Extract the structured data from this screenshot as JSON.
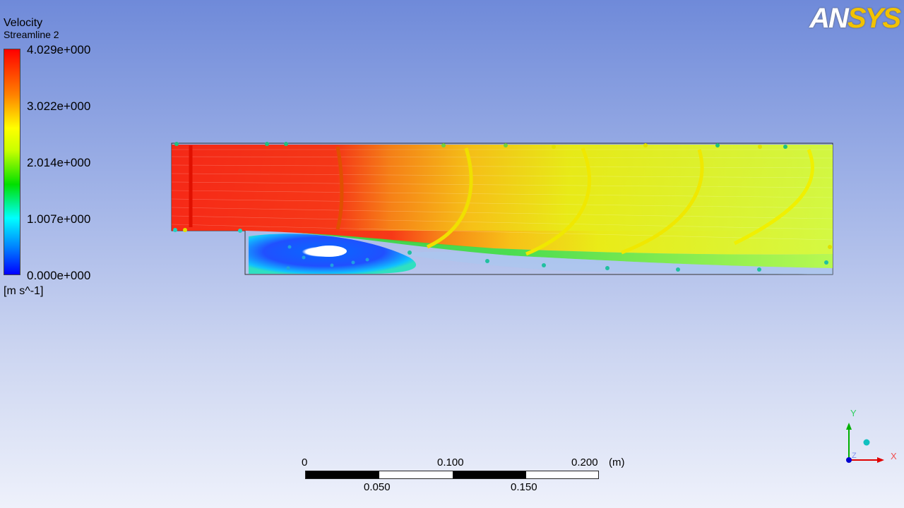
{
  "legend": {
    "title": "Velocity",
    "subtitle": "Streamline 2",
    "ticks": [
      "4.029e+000",
      "3.022e+000",
      "2.014e+000",
      "1.007e+000",
      "0.000e+000"
    ],
    "unit": "[m s^-1]"
  },
  "logo": {
    "part1": "AN",
    "part2": "SYS"
  },
  "scale": {
    "top_labels": [
      "0",
      "0.100",
      "0.200"
    ],
    "unit": "(m)",
    "bottom_labels": [
      "0.050",
      "0.150"
    ]
  },
  "triad": {
    "x": "X",
    "y": "Y",
    "z": "Z"
  },
  "colors": {
    "max": "#ff0000",
    "mid": "#ffff00",
    "low": "#00e000",
    "min": "#0000ff"
  }
}
